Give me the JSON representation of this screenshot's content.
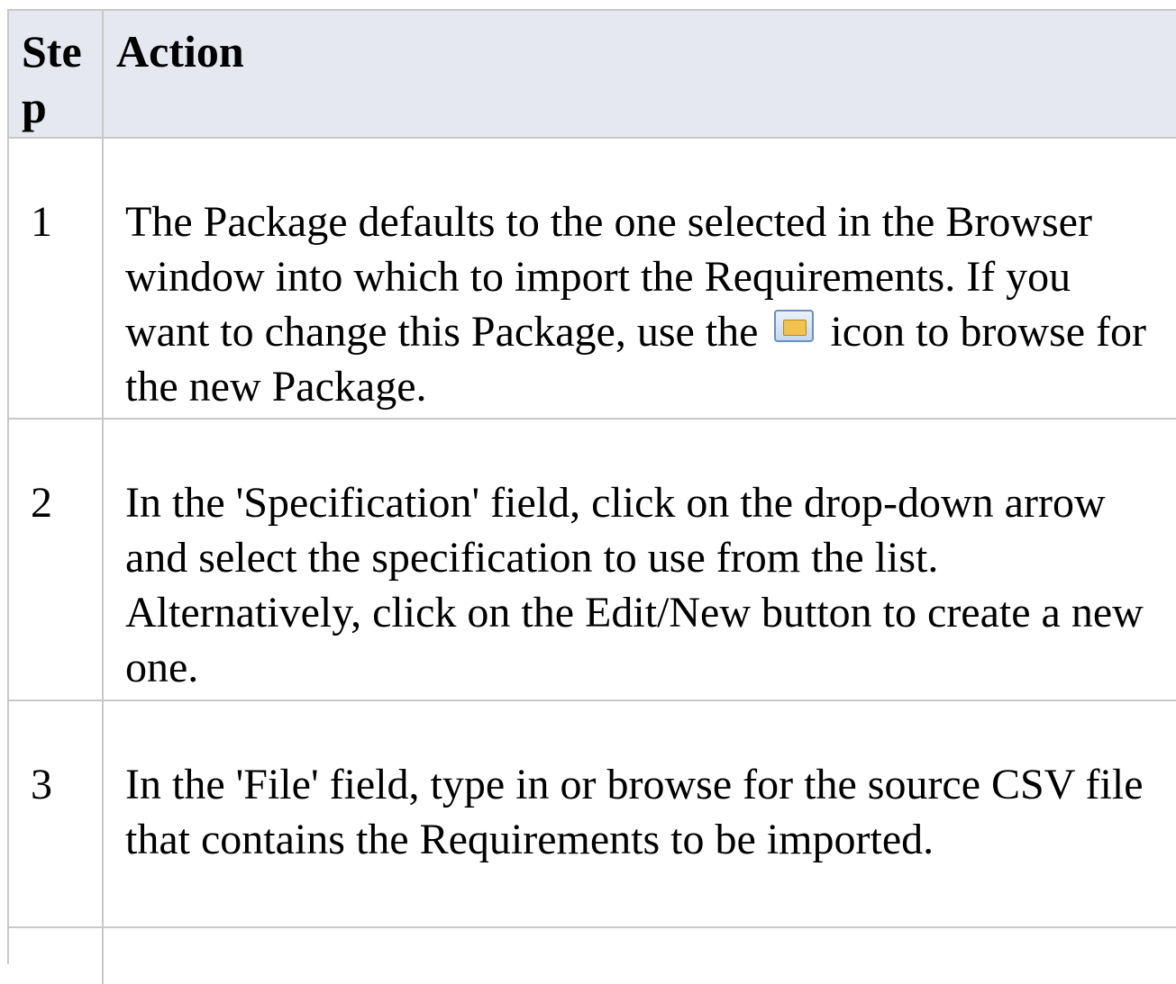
{
  "table": {
    "header": {
      "step": "Ste p",
      "action": "Action"
    },
    "rows": [
      {
        "step": "1",
        "action_before_icon": "The Package defaults to the one selected in the Browser window into which to import the Requirements. If you want to change this Package, use the",
        "icon": "browse-package-icon",
        "action_after_icon": "icon to browse for the new Package."
      },
      {
        "step": "2",
        "action": "In the 'Specification' field, click on the drop-down arrow and select the specification to use from the list. Alternatively, click on the Edit/New button to create a new one."
      },
      {
        "step": "3",
        "action": "In the 'File' field, type in or browse for the source CSV file that contains the Requirements to be imported."
      },
      {
        "step": "",
        "action": ""
      }
    ]
  }
}
